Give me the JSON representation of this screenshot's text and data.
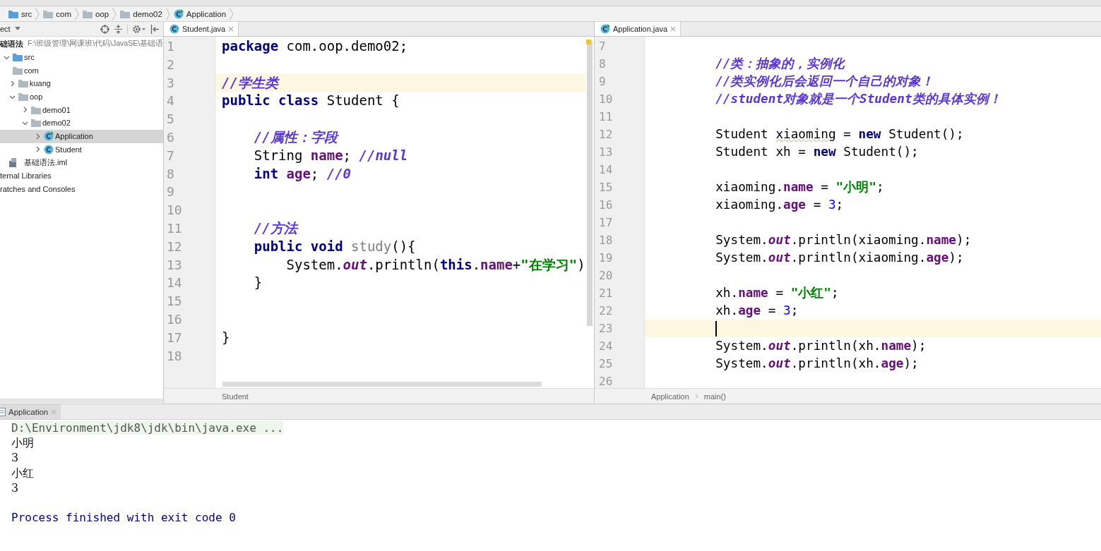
{
  "navigation_bar": [
    {
      "text": "src",
      "kind": "source-folder"
    },
    {
      "text": "com",
      "kind": "folder"
    },
    {
      "text": "oop",
      "kind": "folder"
    },
    {
      "text": "demo02",
      "kind": "folder"
    },
    {
      "text": "Application",
      "kind": "main-class"
    }
  ],
  "project": {
    "title": "ect",
    "tree": [
      {
        "name": "础语法",
        "path": "F:\\班级管理\\网课班\\代码\\JavaSE\\基础语",
        "kind": "module",
        "expanded": true,
        "selected": false,
        "children": [
          {
            "name": "src",
            "kind": "source-folder",
            "expanded": true,
            "selected": false,
            "children": [
              {
                "name": "com",
                "kind": "folder",
                "selected": false,
                "children": [
                  {
                    "name": "kuang",
                    "kind": "folder",
                    "expanded": false,
                    "selected": false
                  },
                  {
                    "name": "oop",
                    "kind": "folder",
                    "expanded": true,
                    "selected": false,
                    "children": [
                      {
                        "name": "demo01",
                        "kind": "folder",
                        "expanded": false,
                        "selected": false
                      },
                      {
                        "name": "demo02",
                        "kind": "folder",
                        "expanded": true,
                        "selected": false,
                        "children": [
                          {
                            "name": "Application",
                            "kind": "main-class",
                            "expanded": false,
                            "selected": true
                          },
                          {
                            "name": "Student",
                            "kind": "class",
                            "expanded": false,
                            "selected": false
                          }
                        ]
                      }
                    ]
                  }
                ]
              }
            ]
          },
          {
            "name": "基础语法.iml",
            "kind": "module-file",
            "selected": false
          }
        ]
      },
      {
        "name": "ternal Libraries",
        "kind": "library",
        "selected": false
      },
      {
        "name": "ratches and Consoles",
        "kind": "scratches",
        "selected": false
      }
    ]
  },
  "editors": [
    {
      "focused": false,
      "tabs": [
        {
          "label": "Student.java",
          "kind": "class",
          "selected": true
        }
      ],
      "lines": [
        {
          "number": "1",
          "current": false,
          "tokens": [
            {
              "kind": "kw",
              "text": "package "
            },
            {
              "kind": "txt",
              "text": "com.oop.demo02;"
            }
          ]
        },
        {
          "number": "2",
          "current": false
        },
        {
          "number": "3",
          "current": true,
          "tokens": [
            {
              "kind": "cmt",
              "text": "//学生类"
            }
          ]
        },
        {
          "number": "4",
          "current": false,
          "tokens": [
            {
              "kind": "kw",
              "text": "public class "
            },
            {
              "kind": "txt",
              "text": "Student {"
            }
          ]
        },
        {
          "number": "5",
          "current": false
        },
        {
          "number": "6",
          "current": false,
          "tokens": [
            {
              "kind": "cmt",
              "text": "    //属性：字段"
            }
          ]
        },
        {
          "number": "7",
          "current": false,
          "tokens": [
            {
              "kind": "txt",
              "text": "    String "
            },
            {
              "kind": "fld",
              "text": "name"
            },
            {
              "kind": "txt",
              "text": "; "
            },
            {
              "kind": "cmt",
              "text": "//null"
            }
          ]
        },
        {
          "number": "8",
          "current": false,
          "tokens": [
            {
              "kind": "kw",
              "text": "    int "
            },
            {
              "kind": "fld",
              "text": "age"
            },
            {
              "kind": "txt",
              "text": "; "
            },
            {
              "kind": "cmt",
              "text": "//0"
            }
          ]
        },
        {
          "number": "9",
          "current": false
        },
        {
          "number": "10",
          "current": false
        },
        {
          "number": "11",
          "current": false,
          "tokens": [
            {
              "kind": "cmt",
              "text": "    //方法"
            }
          ]
        },
        {
          "number": "12",
          "current": false,
          "tokens": [
            {
              "kind": "kw",
              "text": "    public void "
            },
            {
              "kind": "unused",
              "text": "study"
            },
            {
              "kind": "txt",
              "text": "(){"
            }
          ]
        },
        {
          "number": "13",
          "current": false,
          "tokens": [
            {
              "kind": "txt",
              "text": "        System."
            },
            {
              "kind": "st",
              "text": "out"
            },
            {
              "kind": "txt",
              "text": ".println("
            },
            {
              "kind": "kw",
              "text": "this"
            },
            {
              "kind": "txt",
              "text": "."
            },
            {
              "kind": "fld",
              "text": "name"
            },
            {
              "kind": "txt",
              "text": "+"
            },
            {
              "kind": "str",
              "text": "\"在学习\""
            },
            {
              "kind": "txt",
              "text": ")"
            }
          ]
        },
        {
          "number": "14",
          "current": false,
          "tokens": [
            {
              "kind": "txt",
              "text": "    }"
            }
          ]
        },
        {
          "number": "15",
          "current": false
        },
        {
          "number": "16",
          "current": false
        },
        {
          "number": "17",
          "current": false,
          "tokens": [
            {
              "kind": "txt",
              "text": "}"
            }
          ]
        },
        {
          "number": "18",
          "current": false
        }
      ],
      "breadcrumbs": [
        "Student"
      ]
    },
    {
      "focused": true,
      "tabs": [
        {
          "label": "Application.java",
          "kind": "main-class",
          "selected": true
        }
      ],
      "lines": [
        {
          "number": "7",
          "current": false
        },
        {
          "number": "8",
          "current": false,
          "tokens": [
            {
              "kind": "cmt",
              "text": "        //类：抽象的，实例化"
            }
          ]
        },
        {
          "number": "9",
          "current": false,
          "tokens": [
            {
              "kind": "cmt",
              "text": "        //类实例化后会返回一个自己的对象！"
            }
          ]
        },
        {
          "number": "10",
          "current": false,
          "tokens": [
            {
              "kind": "cmt",
              "text": "        //student对象就是一个Student类的具体实例！"
            }
          ]
        },
        {
          "number": "11",
          "current": false
        },
        {
          "number": "12",
          "current": false,
          "tokens": [
            {
              "kind": "txt",
              "text": "        Student "
            },
            {
              "kind": "typo",
              "text": "xiaoming"
            },
            {
              "kind": "txt",
              "text": " = "
            },
            {
              "kind": "kw",
              "text": "new "
            },
            {
              "kind": "txt",
              "text": "Student();"
            }
          ]
        },
        {
          "number": "13",
          "current": false,
          "tokens": [
            {
              "kind": "txt",
              "text": "        Student xh = "
            },
            {
              "kind": "kw",
              "text": "new "
            },
            {
              "kind": "txt",
              "text": "Student();"
            }
          ]
        },
        {
          "number": "14",
          "current": false
        },
        {
          "number": "15",
          "current": false,
          "tokens": [
            {
              "kind": "txt",
              "text": "        xiaoming."
            },
            {
              "kind": "fld",
              "text": "name"
            },
            {
              "kind": "txt",
              "text": " = "
            },
            {
              "kind": "str",
              "text": "\"小明\""
            },
            {
              "kind": "txt",
              "text": ";"
            }
          ]
        },
        {
          "number": "16",
          "current": false,
          "tokens": [
            {
              "kind": "txt",
              "text": "        xiaoming."
            },
            {
              "kind": "fld",
              "text": "age"
            },
            {
              "kind": "txt",
              "text": " = "
            },
            {
              "kind": "num",
              "text": "3"
            },
            {
              "kind": "txt",
              "text": ";"
            }
          ]
        },
        {
          "number": "17",
          "current": false
        },
        {
          "number": "18",
          "current": false,
          "tokens": [
            {
              "kind": "txt",
              "text": "        System."
            },
            {
              "kind": "st",
              "text": "out"
            },
            {
              "kind": "txt",
              "text": ".println(xiaoming."
            },
            {
              "kind": "fld",
              "text": "name"
            },
            {
              "kind": "txt",
              "text": ");"
            }
          ]
        },
        {
          "number": "19",
          "current": false,
          "tokens": [
            {
              "kind": "txt",
              "text": "        System."
            },
            {
              "kind": "st",
              "text": "out"
            },
            {
              "kind": "txt",
              "text": ".println(xiaoming."
            },
            {
              "kind": "fld",
              "text": "age"
            },
            {
              "kind": "txt",
              "text": ");"
            }
          ]
        },
        {
          "number": "20",
          "current": false
        },
        {
          "number": "21",
          "current": false,
          "tokens": [
            {
              "kind": "txt",
              "text": "        xh."
            },
            {
              "kind": "fld",
              "text": "name"
            },
            {
              "kind": "txt",
              "text": " = "
            },
            {
              "kind": "str",
              "text": "\"小红\""
            },
            {
              "kind": "txt",
              "text": ";"
            }
          ]
        },
        {
          "number": "22",
          "current": false,
          "tokens": [
            {
              "kind": "txt",
              "text": "        xh."
            },
            {
              "kind": "fld",
              "text": "age"
            },
            {
              "kind": "txt",
              "text": " = "
            },
            {
              "kind": "num",
              "text": "3"
            },
            {
              "kind": "txt",
              "text": ";"
            }
          ]
        },
        {
          "number": "23",
          "current": true
        },
        {
          "number": "24",
          "current": false,
          "tokens": [
            {
              "kind": "txt",
              "text": "        System."
            },
            {
              "kind": "st",
              "text": "out"
            },
            {
              "kind": "txt",
              "text": ".println(xh."
            },
            {
              "kind": "fld",
              "text": "name"
            },
            {
              "kind": "txt",
              "text": ");"
            }
          ]
        },
        {
          "number": "25",
          "current": false,
          "tokens": [
            {
              "kind": "txt",
              "text": "        System."
            },
            {
              "kind": "st",
              "text": "out"
            },
            {
              "kind": "txt",
              "text": ".println(xh."
            },
            {
              "kind": "fld",
              "text": "age"
            },
            {
              "kind": "txt",
              "text": ");"
            }
          ]
        },
        {
          "number": "26",
          "current": false
        }
      ],
      "breadcrumbs": [
        "Application",
        "main()"
      ]
    }
  ],
  "run": {
    "tab": {
      "label": "Application",
      "selected": true
    },
    "console": [
      {
        "kind": "command",
        "text": "D:\\Environment\\jdk8\\jdk\\bin\\java.exe ..."
      },
      {
        "kind": "output",
        "text": "小明"
      },
      {
        "kind": "output",
        "text": "3"
      },
      {
        "kind": "output",
        "text": "小红"
      },
      {
        "kind": "output",
        "text": "3"
      },
      {
        "kind": "blank"
      },
      {
        "kind": "exit",
        "text": "Process finished with exit code 0"
      }
    ]
  }
}
